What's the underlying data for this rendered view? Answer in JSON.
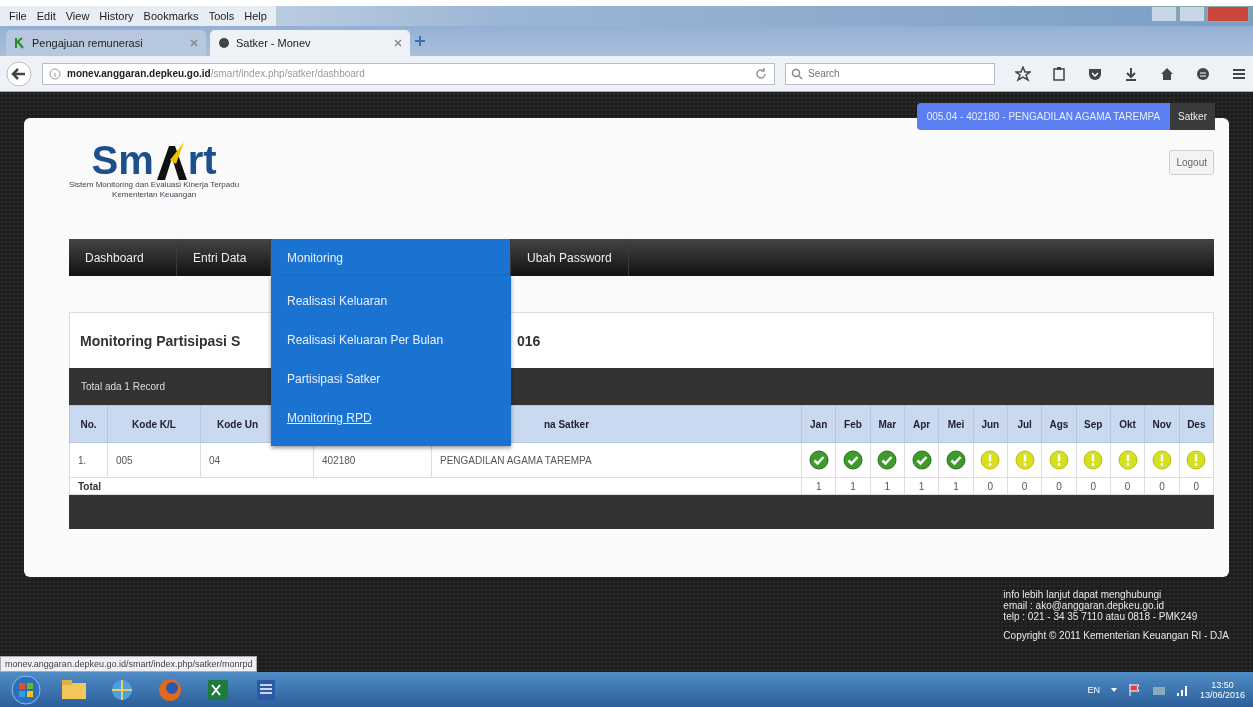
{
  "browser": {
    "menu": [
      "File",
      "Edit",
      "View",
      "History",
      "Bookmarks",
      "Tools",
      "Help"
    ],
    "tabs": [
      {
        "label": "Pengajuan remunerasi",
        "selected": false
      },
      {
        "label": "Satker - Monev",
        "selected": true
      }
    ],
    "url_host": "monev.anggaran.depkeu.go.id",
    "url_path": "/smart/index.php/satker/dashboard",
    "search": {
      "placeholder": "Search"
    },
    "status_url": "monev.anggaran.depkeu.go.id/smart/index.php/satker/monrpd"
  },
  "header": {
    "user": "005.04 - 402180 - PENGADILAN AGAMA TAREMPA",
    "role": "Satker",
    "logout": "Logout",
    "logo": {
      "word_start": "Sm",
      "word_end": "rt",
      "tagline": "Sistem Monitoring dan Evaluasi Kinerja Terpadu",
      "org": "Kementerian Keuangan"
    }
  },
  "nav": [
    {
      "label": "Dashboard",
      "selected": false
    },
    {
      "label": "Entri Data",
      "selected": false
    },
    {
      "label": "Monitoring",
      "selected": true
    },
    {
      "label": "Ubah Password",
      "selected": false
    }
  ],
  "dropdown": [
    {
      "label": "Realisasi Keluaran",
      "hover": false
    },
    {
      "label": "Realisasi Keluaran Per Bulan",
      "hover": false
    },
    {
      "label": "Partisipasi Satker",
      "hover": false
    },
    {
      "label": "Monitoring RPD",
      "hover": true
    }
  ],
  "panel": {
    "title_start": "Monitoring Partisipasi S",
    "title_end": "016",
    "record_count": "Total ada 1 Record",
    "columns": [
      {
        "label": "No."
      },
      {
        "label": "Kode K/L"
      },
      {
        "label": "Kode Un"
      },
      {},
      {
        "label": "na Satker"
      }
    ],
    "months": [
      "Jan",
      "Feb",
      "Mar",
      "Apr",
      "Mei",
      "Jun",
      "Jul",
      "Ags",
      "Sep",
      "Okt",
      "Nov",
      "Des"
    ],
    "rows": [
      {
        "cells": [
          "1.",
          "005",
          "04",
          "402180",
          "PENGADILAN AGAMA TAREMPA"
        ],
        "statuses": [
          {
            "kind": "check"
          },
          {
            "kind": "check"
          },
          {
            "kind": "check"
          },
          {
            "kind": "check"
          },
          {
            "kind": "check"
          },
          {
            "kind": "warning"
          },
          {
            "kind": "warning"
          },
          {
            "kind": "warning"
          },
          {
            "kind": "warning"
          },
          {
            "kind": "warning"
          },
          {
            "kind": "warning"
          },
          {
            "kind": "warning"
          }
        ]
      }
    ],
    "total_label": "Total",
    "totals": [
      "1",
      "1",
      "1",
      "1",
      "1",
      "0",
      "0",
      "0",
      "0",
      "0",
      "0",
      "0"
    ]
  },
  "footer": {
    "lines": [
      "info lebih lanjut dapat menghubungi",
      "email : ako@anggaran.depkeu.go.id",
      "telp : 021 - 34 35 7110 atau 0818 - PMK249"
    ],
    "copyright": "Copyright © 2011 Kementerian Keuangan RI - DJA"
  },
  "taskbar": {
    "lang": "EN",
    "time": "13:50",
    "date": "13/06/2016"
  }
}
